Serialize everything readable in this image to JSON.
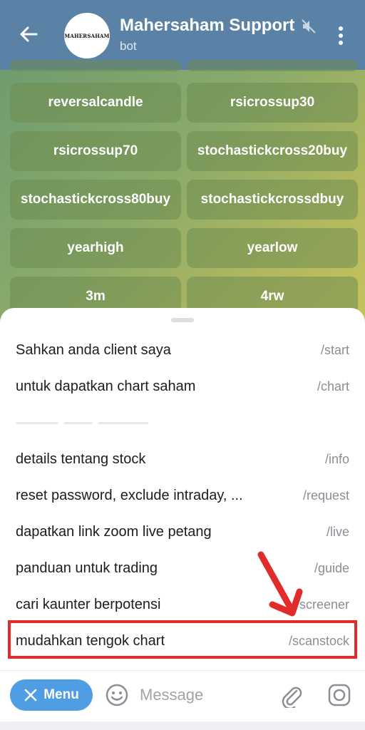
{
  "header": {
    "title": "Mahersaham Support",
    "subtitle": "bot",
    "avatar_text": "MAHERSAHAM"
  },
  "keyboard": {
    "rows": [
      [
        "reversalcandle",
        "rsicrossup30"
      ],
      [
        "rsicrossup70",
        "stochastickcross20buy"
      ],
      [
        "stochastickcross80buy",
        "stochastickcrossdbuy"
      ],
      [
        "yearhigh",
        "yearlow"
      ],
      [
        "3m",
        "4rw"
      ]
    ]
  },
  "commands": [
    {
      "desc": "Sahkan anda client saya",
      "cmd": "/start"
    },
    {
      "desc": "untuk dapatkan chart saham",
      "cmd": "/chart"
    },
    {
      "desc": "details tentang stock",
      "cmd": "/info"
    },
    {
      "desc": "reset password, exclude intraday, ...",
      "cmd": "/request"
    },
    {
      "desc": "dapatkan link zoom live petang",
      "cmd": "/live"
    },
    {
      "desc": "panduan untuk trading",
      "cmd": "/guide"
    },
    {
      "desc": "cari kaunter berpotensi",
      "cmd": "/screener"
    },
    {
      "desc": "mudahkan tengok chart",
      "cmd": "/scanstock"
    }
  ],
  "input": {
    "menu_label": "Menu",
    "placeholder": "Message"
  },
  "colors": {
    "header": "#5a82a6",
    "menu_button": "#4f9ee4",
    "highlight": "#e22b2b"
  }
}
